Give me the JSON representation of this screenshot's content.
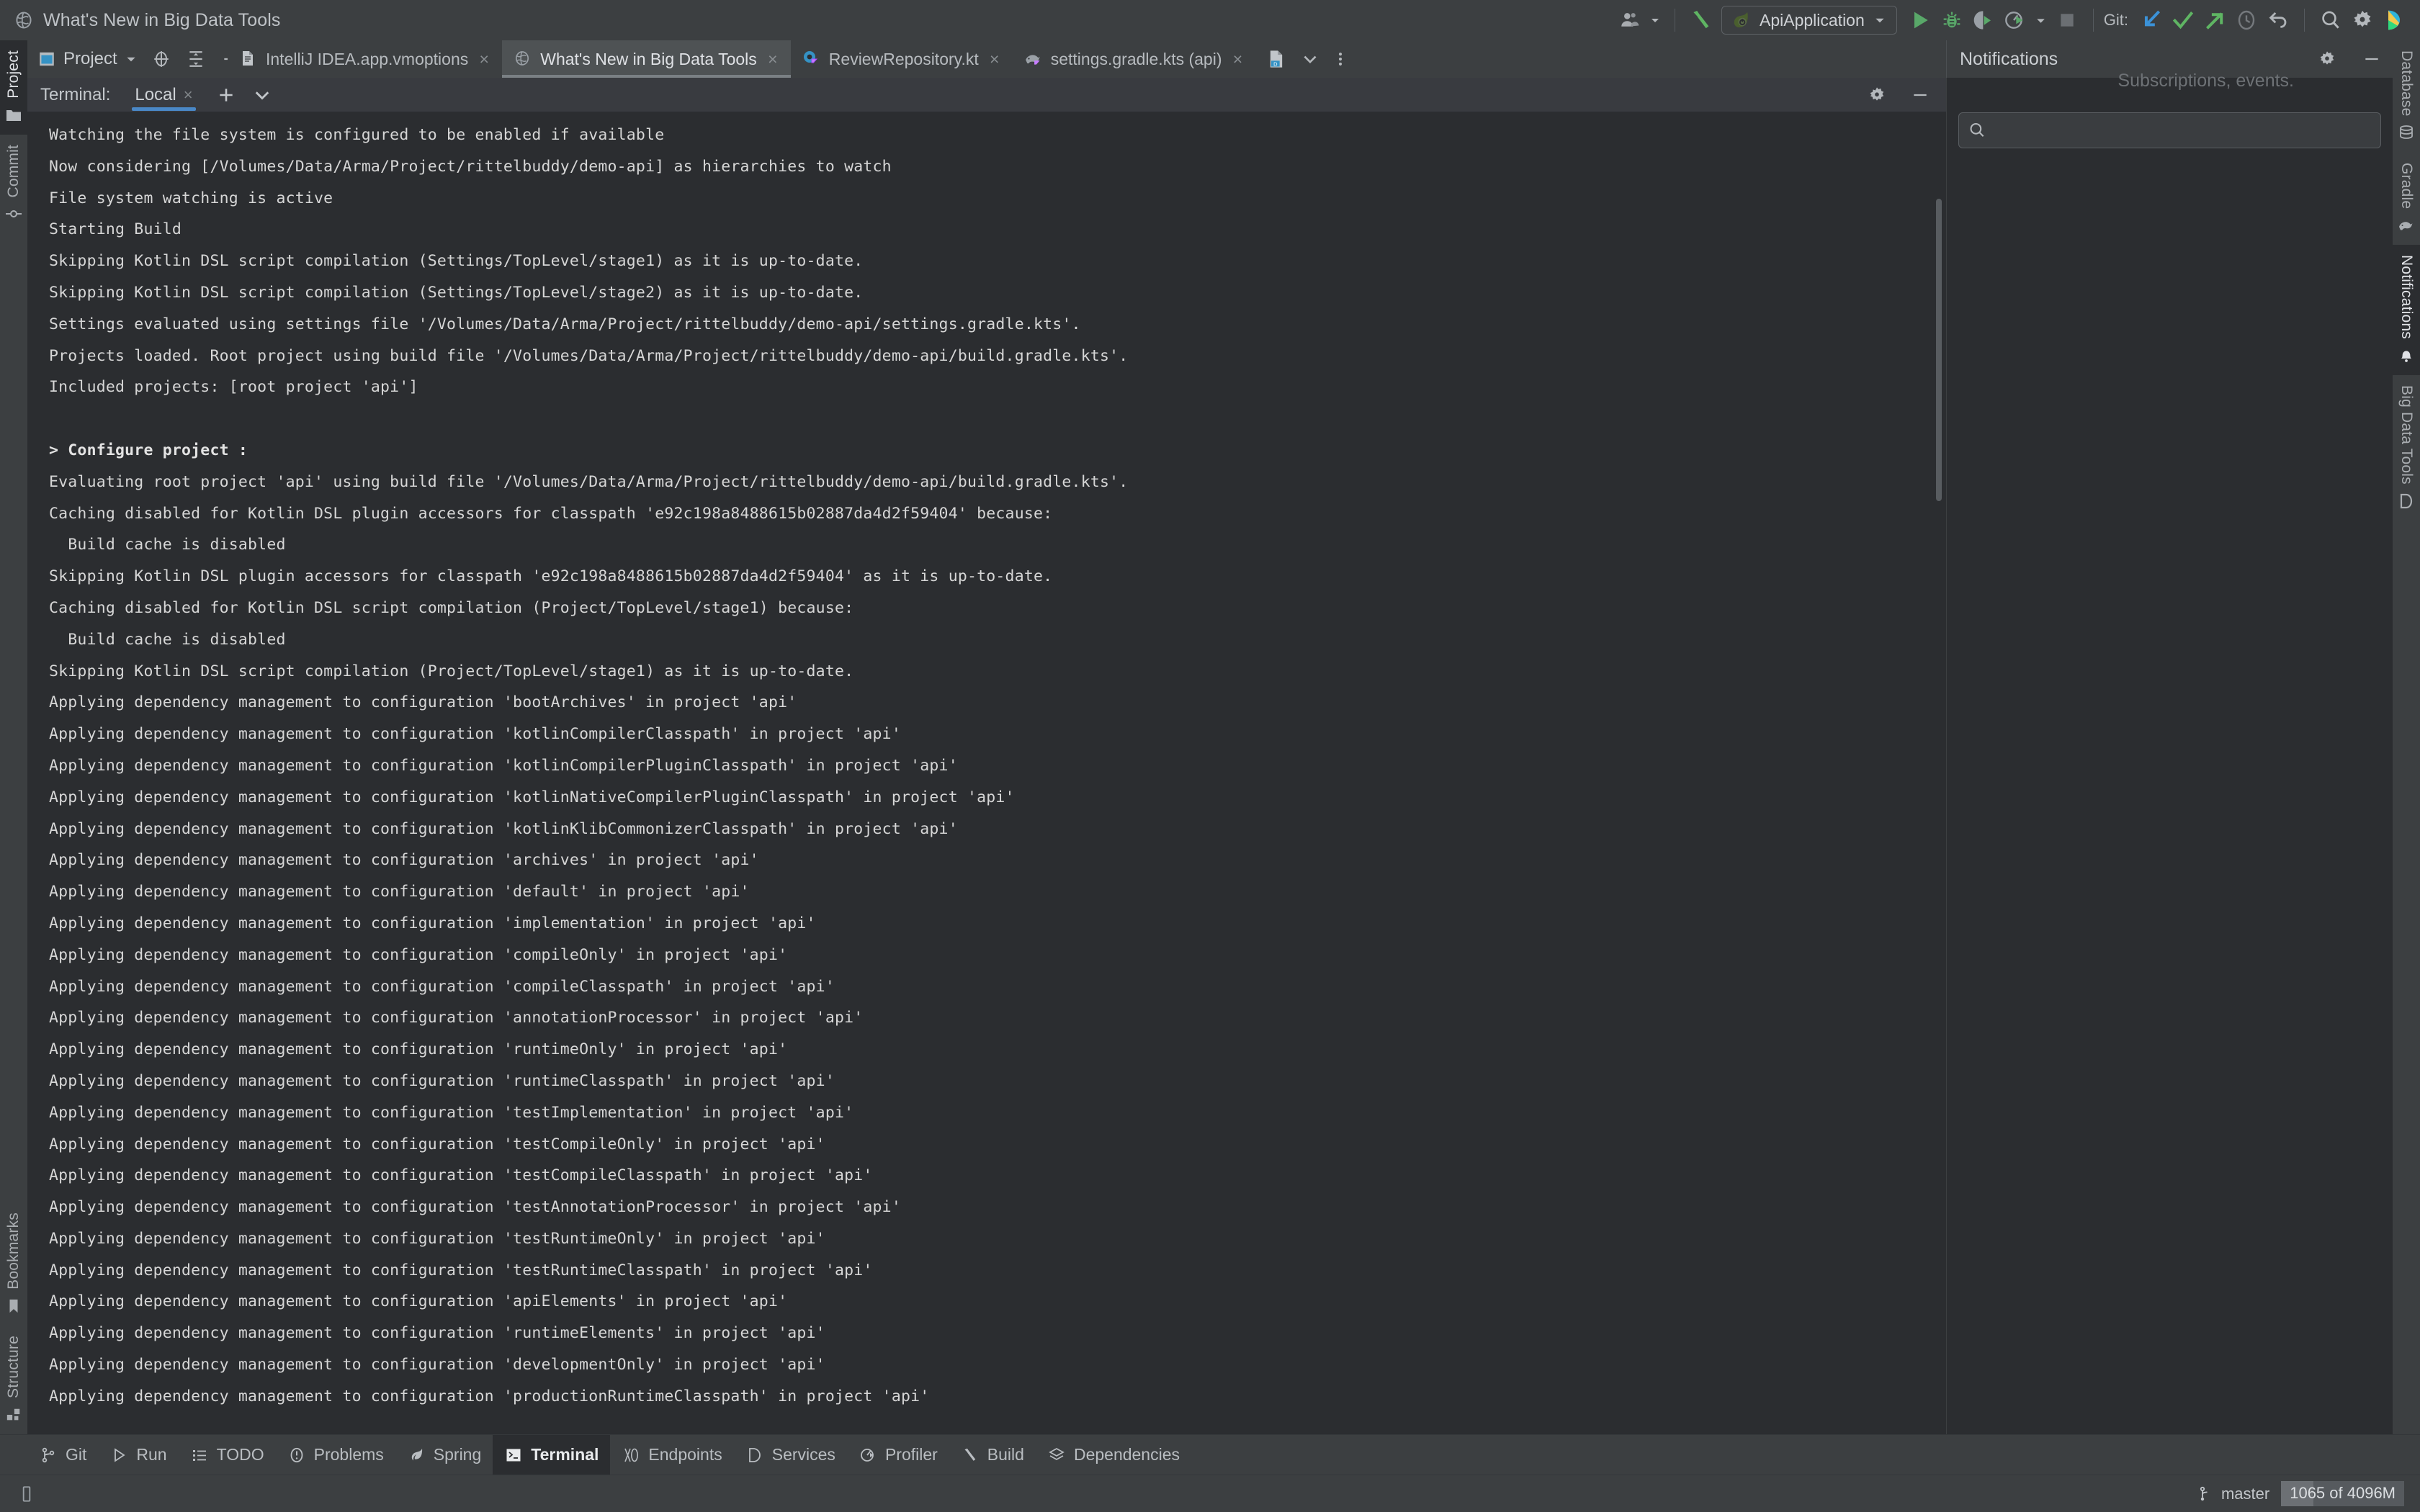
{
  "window": {
    "title": "What's New in Big Data Tools",
    "app_icon": "globe-icon"
  },
  "titlebar": {
    "account_icon": "user-account-icon",
    "account_chevron": "chevron-down-icon",
    "build_icon": "hammer-icon",
    "run_config": {
      "icon": "spring-boot-icon",
      "name": "ApiApplication",
      "chevron": "chevron-down-icon"
    },
    "actions": [
      {
        "name": "run-button",
        "icon": "play-icon"
      },
      {
        "name": "debug-button",
        "icon": "bug-icon"
      },
      {
        "name": "run-with-coverage-button",
        "icon": "coverage-icon"
      },
      {
        "name": "profile-button",
        "icon": "profiler-icon"
      },
      {
        "name": "profile-dropdown",
        "icon": "chevron-down-icon"
      },
      {
        "name": "stop-button",
        "icon": "stop-icon"
      }
    ],
    "git": {
      "label": "Git:",
      "update_project": "update-project-icon",
      "commit": "commit-checkmark-icon",
      "push": "push-arrow-icon",
      "history": "history-clock-icon",
      "rollback": "rollback-icon"
    },
    "search_icon": "search-icon",
    "settings_icon": "gear-icon",
    "ide_icon": "intellij-idea-icon"
  },
  "left_rail": {
    "top": [
      {
        "label": "Project",
        "icon": "folder-icon",
        "active": true
      },
      {
        "label": "Commit",
        "icon": "commit-icon",
        "active": false
      }
    ],
    "bottom": [
      {
        "label": "Bookmarks",
        "icon": "bookmark-icon",
        "active": false
      },
      {
        "label": "Structure",
        "icon": "structure-icon",
        "active": false
      }
    ]
  },
  "right_rail": {
    "top": [
      {
        "label": "Database",
        "icon": "database-icon",
        "active": false
      },
      {
        "label": "Gradle",
        "icon": "gradle-elephant-icon",
        "active": false
      },
      {
        "label": "Notifications",
        "icon": "bell-icon",
        "active": true
      },
      {
        "label": "Big Data Tools",
        "icon": "big-data-tools-icon",
        "active": false
      }
    ]
  },
  "project_header": {
    "icon": "project-view-icon",
    "title": "Project",
    "chevron": "chevron-down-icon",
    "actions": [
      {
        "name": "select-opened-file-button",
        "icon": "crosshair-target-icon"
      },
      {
        "name": "expand-all-button",
        "icon": "expand-all-icon"
      },
      {
        "name": "collapse-all-button",
        "icon": "collapse-all-icon"
      },
      {
        "name": "project-options-button",
        "icon": "gear-icon"
      },
      {
        "name": "hide-project-button",
        "icon": "minimize-icon"
      }
    ]
  },
  "editor_tabs": [
    {
      "label": "IntelliJ IDEA.app.vmoptions",
      "icon": "file-text-icon",
      "selected": false,
      "close": "×"
    },
    {
      "label": "What's New in Big Data Tools",
      "icon": "globe-icon",
      "selected": true,
      "close": "×"
    },
    {
      "label": "ReviewRepository.kt",
      "icon": "kotlin-class-icon",
      "selected": false,
      "close": "×"
    },
    {
      "label": "settings.gradle.kts (api)",
      "icon": "gradle-kotlin-icon",
      "selected": false,
      "close": "×"
    }
  ],
  "editor_tabs_extra": [
    {
      "name": "diff-file-icon",
      "icon": "diff-file-icon"
    },
    {
      "name": "tab-list-chevron",
      "icon": "chevron-down-icon"
    },
    {
      "name": "tab-more-options",
      "icon": "more-vertical-icon"
    }
  ],
  "notifications": {
    "title": "Notifications",
    "settings_icon": "gear-icon",
    "hide_icon": "minimize-icon",
    "search_placeholder": "",
    "search_value": "",
    "search_icon": "search-icon",
    "ghost_text": "Subscriptions, events."
  },
  "terminal": {
    "label": "Terminal:",
    "tabs": [
      {
        "label": "Local",
        "selected": true,
        "close": "×"
      }
    ],
    "new_tab_icon": "plus-icon",
    "tab_list_icon": "chevron-down-icon",
    "settings_icon": "gear-icon",
    "hide_icon": "minimize-icon",
    "lines": [
      "Watching the file system is configured to be enabled if available",
      "Now considering [/Volumes/Data/Arma/Project/rittelbuddy/demo-api] as hierarchies to watch",
      "File system watching is active",
      "Starting Build",
      "Skipping Kotlin DSL script compilation (Settings/TopLevel/stage1) as it is up-to-date.",
      "Skipping Kotlin DSL script compilation (Settings/TopLevel/stage2) as it is up-to-date.",
      "Settings evaluated using settings file '/Volumes/Data/Arma/Project/rittelbuddy/demo-api/settings.gradle.kts'.",
      "Projects loaded. Root project using build file '/Volumes/Data/Arma/Project/rittelbuddy/demo-api/build.gradle.kts'.",
      "Included projects: [root project 'api']",
      "",
      "> Configure project :",
      "Evaluating root project 'api' using build file '/Volumes/Data/Arma/Project/rittelbuddy/demo-api/build.gradle.kts'.",
      "Caching disabled for Kotlin DSL plugin accessors for classpath 'e92c198a8488615b02887da4d2f59404' because:",
      "  Build cache is disabled",
      "Skipping Kotlin DSL plugin accessors for classpath 'e92c198a8488615b02887da4d2f59404' as it is up-to-date.",
      "Caching disabled for Kotlin DSL script compilation (Project/TopLevel/stage1) because:",
      "  Build cache is disabled",
      "Skipping Kotlin DSL script compilation (Project/TopLevel/stage1) as it is up-to-date.",
      "Applying dependency management to configuration 'bootArchives' in project 'api'",
      "Applying dependency management to configuration 'kotlinCompilerClasspath' in project 'api'",
      "Applying dependency management to configuration 'kotlinCompilerPluginClasspath' in project 'api'",
      "Applying dependency management to configuration 'kotlinNativeCompilerPluginClasspath' in project 'api'",
      "Applying dependency management to configuration 'kotlinKlibCommonizerClasspath' in project 'api'",
      "Applying dependency management to configuration 'archives' in project 'api'",
      "Applying dependency management to configuration 'default' in project 'api'",
      "Applying dependency management to configuration 'implementation' in project 'api'",
      "Applying dependency management to configuration 'compileOnly' in project 'api'",
      "Applying dependency management to configuration 'compileClasspath' in project 'api'",
      "Applying dependency management to configuration 'annotationProcessor' in project 'api'",
      "Applying dependency management to configuration 'runtimeOnly' in project 'api'",
      "Applying dependency management to configuration 'runtimeClasspath' in project 'api'",
      "Applying dependency management to configuration 'testImplementation' in project 'api'",
      "Applying dependency management to configuration 'testCompileOnly' in project 'api'",
      "Applying dependency management to configuration 'testCompileClasspath' in project 'api'",
      "Applying dependency management to configuration 'testAnnotationProcessor' in project 'api'",
      "Applying dependency management to configuration 'testRuntimeOnly' in project 'api'",
      "Applying dependency management to configuration 'testRuntimeClasspath' in project 'api'",
      "Applying dependency management to configuration 'apiElements' in project 'api'",
      "Applying dependency management to configuration 'runtimeElements' in project 'api'",
      "Applying dependency management to configuration 'developmentOnly' in project 'api'",
      "Applying dependency management to configuration 'productionRuntimeClasspath' in project 'api'"
    ],
    "bold_line_index": 10
  },
  "bottom_bar": [
    {
      "label": "Git",
      "icon": "git-branch-icon",
      "active": false
    },
    {
      "label": "Run",
      "icon": "play-icon",
      "active": false
    },
    {
      "label": "TODO",
      "icon": "todo-list-icon",
      "active": false
    },
    {
      "label": "Problems",
      "icon": "problems-icon",
      "active": false
    },
    {
      "label": "Spring",
      "icon": "spring-leaf-icon",
      "active": false
    },
    {
      "label": "Terminal",
      "icon": "terminal-icon",
      "active": true
    },
    {
      "label": "Endpoints",
      "icon": "endpoints-icon",
      "active": false
    },
    {
      "label": "Services",
      "icon": "services-icon",
      "active": false
    },
    {
      "label": "Profiler",
      "icon": "profiler-icon",
      "active": false
    },
    {
      "label": "Build",
      "icon": "hammer-icon",
      "active": false
    },
    {
      "label": "Dependencies",
      "icon": "dependencies-icon",
      "active": false
    }
  ],
  "status_bar": {
    "branch_icon": "git-branch-icon",
    "branch": "master",
    "memory": "1065 of 4096M",
    "memory_percent": 26
  },
  "colors": {
    "window_bg": "#3c3f41",
    "content_bg": "#2b2d30",
    "accent_blue": "#4a88c7",
    "accent_green": "#59a869",
    "text_primary": "#d6d6d6",
    "text_muted": "#b9bdc1"
  }
}
